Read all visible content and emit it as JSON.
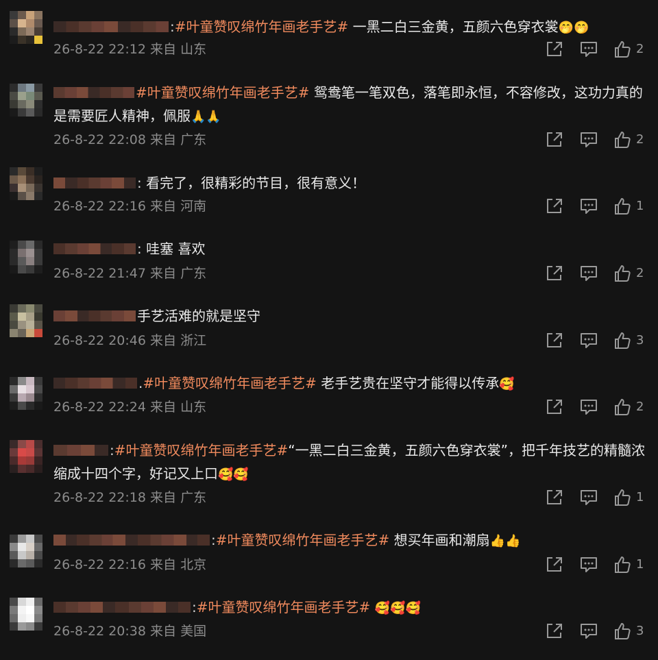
{
  "icons": {
    "share": "share-icon",
    "comment": "comment-icon",
    "like": "thumbs-up-icon"
  },
  "colors": {
    "background": "#141414",
    "hashtag": "#f08a5d",
    "meta": "#8c8c8c"
  },
  "comments": [
    {
      "avatar": [
        "#3a3a3a",
        "#6b5a4d",
        "#c8a27a",
        "#8a7460",
        "#5c5048",
        "#d7b48e",
        "#b08b6c",
        "#6a5a50",
        "#2a2a2a",
        "#7c6a58",
        "#9c8470",
        "#4a3e36",
        "#1c1c1c",
        "#3a3228",
        "#2a2620",
        "#e8c23a"
      ],
      "username_w": 168,
      "colon": ":",
      "hashtag": "#叶童赞叹绵竹年画老手艺#",
      "body": " 一黑二白三金黄，五颜六色穿衣裳",
      "emoji": "🤭🤭",
      "time": "26-8-22 22:12",
      "from": "来自",
      "location": "山东",
      "likes": "2"
    },
    {
      "avatar": [
        "#2c2c2c",
        "#6d7880",
        "#8a9aa4",
        "#3a3a3a",
        "#4a4a44",
        "#9aa08c",
        "#7a8a78",
        "#5a5a50",
        "#3a3a34",
        "#6a6a60",
        "#8a8a7a",
        "#2e2e2e",
        "#1a1a1a",
        "#3a3a3a",
        "#5a5a5a",
        "#2a2a2a"
      ],
      "username_w": 118,
      "colon": "",
      "hashtag": "#叶童赞叹绵竹年画老手艺#",
      "body": " 鸳鸯笔一笔双色，落笔即永恒，不容修改，这功力真的是需要匠人精神，佩服",
      "emoji": "🙏🙏",
      "time": "26-8-22 22:08",
      "from": "来自",
      "location": "广东",
      "likes": "2"
    },
    {
      "avatar": [
        "#2a2a2a",
        "#5a4a3a",
        "#3a2e26",
        "#1e1e1e",
        "#6a5848",
        "#8a7058",
        "#4a3a30",
        "#2a2420",
        "#3a3030",
        "#a89078",
        "#7a6a5a",
        "#3a3430",
        "#1a1a1a",
        "#5a5048",
        "#8a7a6a",
        "#2a2a2a"
      ],
      "username_w": 120,
      "colon": ":",
      "hashtag": "",
      "body": " 看完了，很精彩的节目，很有意义！",
      "emoji": "",
      "time": "26-8-22 22:16",
      "from": "来自",
      "location": "河南",
      "likes": "1"
    },
    {
      "avatar": [
        "#1e1e1e",
        "#4a4a4a",
        "#6a6a6a",
        "#2a2a2a",
        "#2a2a2a",
        "#7a7070",
        "#9a9090",
        "#3a3a3a",
        "#2a2a2a",
        "#5a5a5a",
        "#8a8080",
        "#3a3a3a",
        "#1a1a1a",
        "#4a4a4a",
        "#3a3a3a",
        "#1e1e1e"
      ],
      "username_w": 120,
      "colon": ":",
      "hashtag": "",
      "body": " 哇塞 喜欢",
      "emoji": "",
      "time": "26-8-22 21:47",
      "from": "来自",
      "location": "广东",
      "likes": "2"
    },
    {
      "avatar": [
        "#3a3a34",
        "#6a6a5a",
        "#8a8a70",
        "#4a4a40",
        "#5a5a4a",
        "#c8c0a0",
        "#a8a088",
        "#3a3a30",
        "#4a4a40",
        "#9a9280",
        "#b8b098",
        "#5a5448",
        "#8a8470",
        "#6a6458",
        "#c8a878",
        "#c84a3a"
      ],
      "username_w": 120,
      "colon": "",
      "hashtag": "",
      "body": "手艺活难的就是坚守",
      "emoji": "",
      "time": "26-8-22 20:46",
      "from": "来自",
      "location": "浙江",
      "likes": "3"
    },
    {
      "avatar": [
        "#2a2a2a",
        "#8a8a8a",
        "#c8b8c0",
        "#3a3a3a",
        "#6a6a6a",
        "#e8e0e4",
        "#d8c8d0",
        "#4a4a4a",
        "#3a3a3a",
        "#b8a8b0",
        "#9a8a90",
        "#2e2e2e",
        "#1e1e1e",
        "#4a4a4a",
        "#2a2a2a",
        "#1a1a1a"
      ],
      "username_w": 122,
      "colon": ".",
      "hashtag": "#叶童赞叹绵竹年画老手艺#",
      "body": " 老手艺贵在坚守才能得以传承",
      "emoji": "🥰",
      "time": "26-8-22 22:24",
      "from": "来自",
      "location": "山东",
      "likes": "2"
    },
    {
      "avatar": [
        "#3a2a2a",
        "#8a4a48",
        "#b84a48",
        "#4a2e2e",
        "#6a3a3a",
        "#d84a48",
        "#c84a48",
        "#5a3434",
        "#4a2a2a",
        "#a83a38",
        "#983a38",
        "#3a2424",
        "#2a2020",
        "#5a3030",
        "#4a2a2a",
        "#2a1e1e"
      ],
      "username_w": 80,
      "colon": ":",
      "hashtag": "#叶童赞叹绵竹年画老手艺#",
      "body": "“一黑二白三金黄，五颜六色穿衣裳”，把千年技艺的精髓浓缩成十四个字，好记又上口",
      "emoji": "🥰🥰",
      "time": "26-8-22 22:18",
      "from": "来自",
      "location": "广东",
      "likes": "1"
    },
    {
      "avatar": [
        "#3a3a3a",
        "#9a9a9a",
        "#c8c8c8",
        "#4a4a4a",
        "#8a8a8a",
        "#e8e8e8",
        "#d8d0c8",
        "#6a6a6a",
        "#5a5a5a",
        "#c8c8c8",
        "#b8b0a8",
        "#4a4a4a",
        "#2a2a2a",
        "#6a6a6a",
        "#5a5a5a",
        "#2a2a2a"
      ],
      "username_w": 228,
      "colon": ":",
      "hashtag": "#叶童赞叹绵竹年画老手艺#",
      "body": " 想买年画和潮扇",
      "emoji": "👍👍",
      "time": "26-8-22 22:16",
      "from": "来自",
      "location": "北京",
      "likes": "1"
    },
    {
      "avatar": [
        "#4a4a4a",
        "#d8d8d8",
        "#f0f0f0",
        "#6a6a6a",
        "#7a7a7a",
        "#f4f4f4",
        "#ffffff",
        "#8a8a8a",
        "#6a6a6a",
        "#eeeeee",
        "#f8f8f8",
        "#7a7a7a",
        "#3a3a3a",
        "#9a9a9a",
        "#8a8a8a",
        "#3a3a3a"
      ],
      "username_w": 200,
      "colon": ":",
      "hashtag": "#叶童赞叹绵竹年画老手艺#",
      "body": " ",
      "emoji": "🥰🥰🥰",
      "time": "26-8-22 20:38",
      "from": "来自",
      "location": "美国",
      "likes": "3"
    }
  ]
}
